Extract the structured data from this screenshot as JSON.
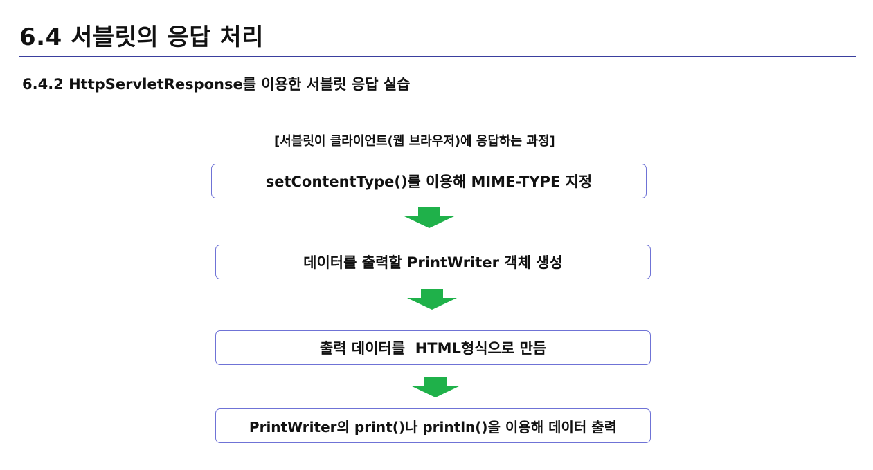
{
  "header": {
    "title": "6.4  서블릿의 응답 처리",
    "subtitle": "6.4.2 HttpServletResponse를 이용한 서블릿 응답 실습"
  },
  "diagram": {
    "caption": "[서블릿이 클라이언트(웹 브라우저)에 응답하는 과정]",
    "steps": [
      {
        "label": "setContentType()를 이용해 MIME-TYPE 지정"
      },
      {
        "label": "데이터를 출력할 PrintWriter 객체 생성"
      },
      {
        "label": "출력 데이터를  HTML형식으로 만듬"
      },
      {
        "label": "PrintWriter의 print()나 println()을 이용해 데이터 출력"
      }
    ],
    "arrow_icon": "down-arrow-icon"
  },
  "colors": {
    "title_rule": "#3a3f9e",
    "box_border": "#6f73d6",
    "arrow": "#1fb14a"
  }
}
